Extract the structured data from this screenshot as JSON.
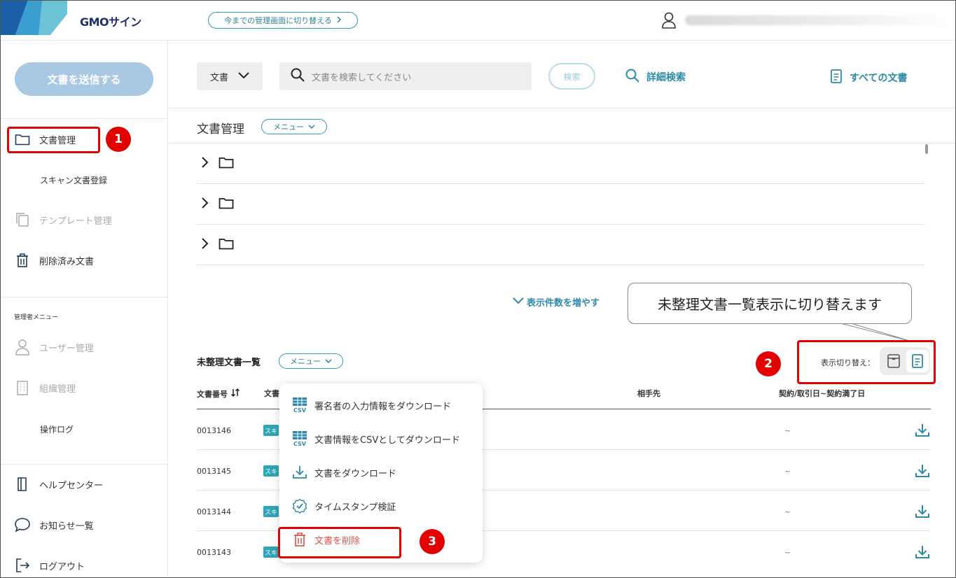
{
  "header": {
    "logo_text": "GMOサイン",
    "switch_button_label": "今までの管理画面に切り替える"
  },
  "sidebar": {
    "send_button": "文書を送信する",
    "items": {
      "documents": "文書管理",
      "scan_register": "スキャン文書登録",
      "templates": "テンプレート管理",
      "deleted": "削除済み文書",
      "admin_caption": "管理者メニュー",
      "users": "ユーザー管理",
      "organization": "組織管理",
      "operation_log": "操作ログ",
      "help": "ヘルプセンター",
      "notices": "お知らせ一覧",
      "logout": "ログアウト"
    }
  },
  "search": {
    "type_select": "文書",
    "placeholder": "文書を検索してください",
    "search_button": "検索",
    "advanced": "詳細検索",
    "all_documents": "すべての文書"
  },
  "doc_management": {
    "title": "文書管理",
    "menu_label": "メニュー",
    "folder_count": 3
  },
  "more_link": "表示件数を増やす",
  "callout_text": "未整理文書一覧表示に切り替えます",
  "unsorted": {
    "title": "未整理文書一覧",
    "menu_label": "メニュー",
    "view_toggle_label": "表示切り替え：",
    "columns": {
      "number": "文書番号",
      "name": "文書",
      "counterparty": "相手先",
      "date": "契約/取引日~契約満了日"
    },
    "rows": [
      {
        "number": "0013146",
        "tag": "スキ",
        "date": "~"
      },
      {
        "number": "0013145",
        "tag": "スキ",
        "date": "~"
      },
      {
        "number": "0013144",
        "tag": "スキ",
        "date": "~"
      },
      {
        "number": "0013143",
        "tag": "スキ",
        "date": "~"
      }
    ]
  },
  "dropdown": {
    "items": [
      {
        "label": "署名者の入力情報をダウンロード",
        "icon": "csv-icon"
      },
      {
        "label": "文書情報をCSVとしてダウンロード",
        "icon": "csv-icon"
      },
      {
        "label": "文書をダウンロード",
        "icon": "download-icon"
      },
      {
        "label": "タイムスタンプ検証",
        "icon": "check-circle-icon"
      },
      {
        "label": "文書を削除",
        "icon": "trash-icon"
      }
    ]
  },
  "annotations": {
    "badge_1": "1",
    "badge_2": "2",
    "badge_3": "3"
  },
  "colors": {
    "accent": "#2e8aa8",
    "send_button": "#a8c8e3",
    "annotation_red": "#e30000",
    "delete_red": "#d9534f"
  }
}
